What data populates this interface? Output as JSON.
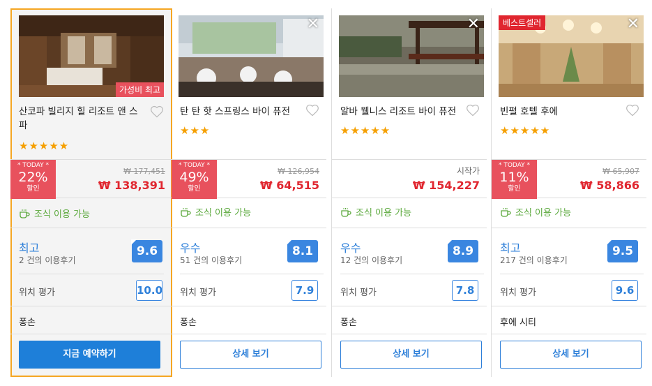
{
  "hotels": [
    {
      "name": "산코파 빌리지 힐 리조트 앤 스파",
      "badge": "가성비 최고",
      "stars": "★★★★★",
      "today": "* TODAY *",
      "discount": "22%",
      "discount_label": "할인",
      "orig_price": "₩ 177,451",
      "price": "₩ 138,391",
      "breakfast": "조식 이용 가능",
      "rating_word": "최고",
      "reviews": "2 건의 이용후기",
      "score": "9.6",
      "loc_label": "위치 평가",
      "loc_score": "10.0",
      "area": "퐁손",
      "button": "지금 예약하기"
    },
    {
      "name": "탄 탄 핫 스프링스 바이 퓨전",
      "stars": "★★★",
      "today": "* TODAY *",
      "discount": "49%",
      "discount_label": "할인",
      "orig_price": "₩ 126,954",
      "price": "₩ 64,515",
      "breakfast": "조식 이용 가능",
      "rating_word": "우수",
      "reviews": "51 건의 이용후기",
      "score": "8.1",
      "loc_label": "위치 평가",
      "loc_score": "7.9",
      "area": "퐁손",
      "button": "상세 보기"
    },
    {
      "name": "알바 웰니스 리조트 바이 퓨전",
      "stars": "★★★★★",
      "start_label": "시작가",
      "price": "₩ 154,227",
      "breakfast": "조식 이용 가능",
      "rating_word": "우수",
      "reviews": "12 건의 이용후기",
      "score": "8.9",
      "loc_label": "위치 평가",
      "loc_score": "7.8",
      "area": "퐁손",
      "button": "상세 보기"
    },
    {
      "name": "빈펄 호텔 후에",
      "badge": "베스트셀러",
      "stars": "★★★★★",
      "today": "* TODAY *",
      "discount": "11%",
      "discount_label": "할인",
      "orig_price": "₩ 65,907",
      "price": "₩ 58,866",
      "breakfast": "조식 이용 가능",
      "rating_word": "최고",
      "reviews": "217 건의 이용후기",
      "score": "9.5",
      "loc_label": "위치 평가",
      "loc_score": "9.6",
      "area": "후에 시티",
      "button": "상세 보기"
    }
  ],
  "icons": {
    "close": "close-icon",
    "heart": "heart-icon",
    "cup": "coffee-cup-icon"
  },
  "colors": {
    "accent": "#1e7fd9",
    "sale": "#e8515d",
    "price": "#e0262f",
    "breakfast": "#5aa83b",
    "selected_border": "#f5a623"
  }
}
